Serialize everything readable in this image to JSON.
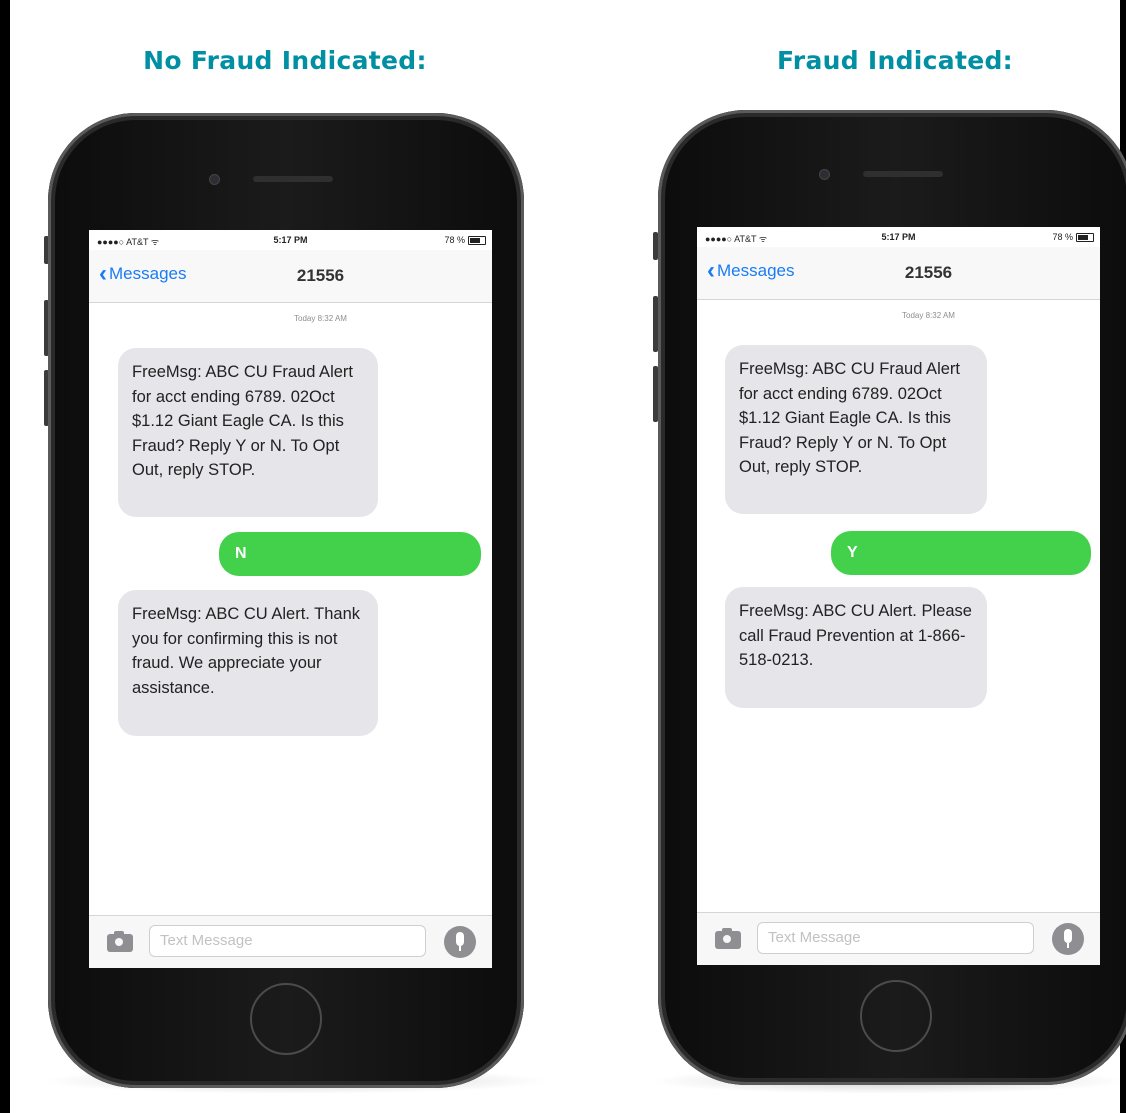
{
  "colors": {
    "heading": "#008fa3",
    "incoming_bubble": "#e5e5ea",
    "outgoing_bubble": "#43d04b",
    "link_blue": "#1a7cf5"
  },
  "left": {
    "heading": "No Fraud Indicated:",
    "status": {
      "carrier": "●●●●○ AT&T ᯤ",
      "time": "5:17 PM",
      "battery": "78 %"
    },
    "nav": {
      "back_label": "Messages",
      "contact": "21556"
    },
    "timestamp": "Today 8:32 AM",
    "incoming_1": "FreeMsg: ABC CU Fraud Alert for acct ending 6789. 02Oct $1.12 Giant Eagle CA. Is this Fraud? Reply Y or N. To Opt Out, reply STOP.",
    "outgoing": "N",
    "incoming_2": "FreeMsg: ABC CU Alert. Thank you for confirming this is not fraud. We appreciate your assistance.",
    "input_placeholder": "Text Message"
  },
  "right": {
    "heading": "Fraud Indicated:",
    "status": {
      "carrier": "●●●●○ AT&T ᯤ",
      "time": "5:17 PM",
      "battery": "78 %"
    },
    "nav": {
      "back_label": "Messages",
      "contact": "21556"
    },
    "timestamp": "Today 8:32 AM",
    "incoming_1": "FreeMsg: ABC CU Fraud Alert for acct ending 6789. 02Oct $1.12 Giant Eagle CA. Is this Fraud? Reply Y or N. To Opt Out, reply STOP.",
    "outgoing": "Y",
    "incoming_2": "FreeMsg: ABC CU Alert. Please call Fraud Prevention at 1-866-518-0213.",
    "input_placeholder": "Text Message"
  }
}
